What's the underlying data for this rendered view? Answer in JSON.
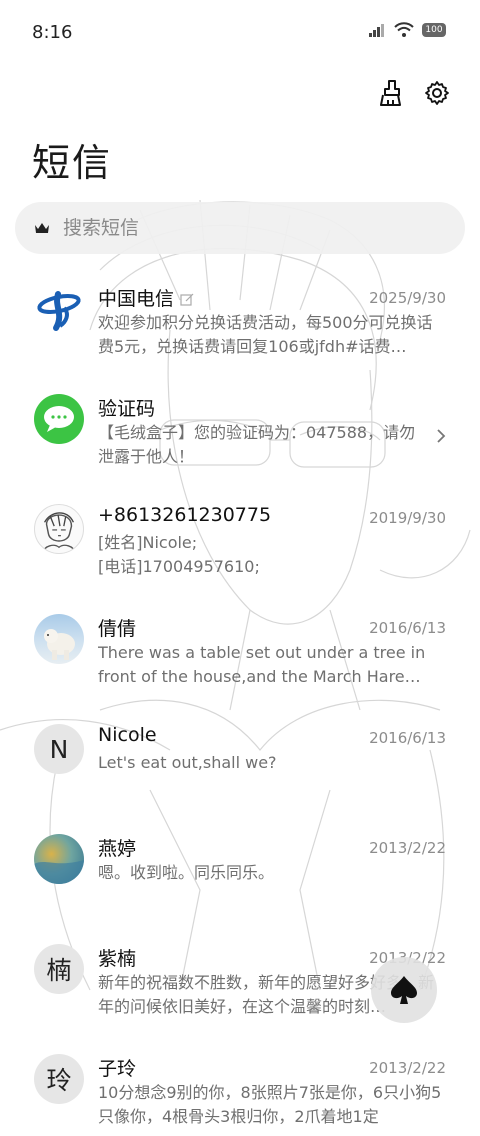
{
  "status_bar": {
    "time": "8:16",
    "battery": "100"
  },
  "page_title": "短信",
  "search": {
    "placeholder": "搜索短信"
  },
  "conversations": [
    {
      "name": "中国电信",
      "date": "2025/9/30",
      "preview": "欢迎参加积分兑换话费活动，每500分可兑换话费5元，兑换话费请回复106或jfdh#话费…",
      "avatar": "china-telecom-logo",
      "badge_icon": "edit-icon"
    },
    {
      "name": "验证码",
      "date": "",
      "preview": "【毛绒盒子】您的验证码为：047588，请勿泄露于他人！",
      "avatar": "message-bubble-icon",
      "has_chevron": true
    },
    {
      "name": "+8613261230775",
      "date": "2019/9/30",
      "preview": "[姓名]Nicole;\n[电话]17004957610;",
      "avatar": "anime-portrait"
    },
    {
      "name": "倩倩",
      "date": "2016/6/13",
      "preview": "There was a table set out under a tree in front of the house,and the March Hare an…",
      "avatar": "polar-bear-photo"
    },
    {
      "name": "Nicole",
      "date": "2016/6/13",
      "preview": "Let's eat out,shall we?",
      "avatar_letter": "N"
    },
    {
      "name": "燕婷",
      "date": "2013/2/22",
      "preview": "嗯。收到啦。同乐同乐。",
      "avatar": "ocean-photo"
    },
    {
      "name": "紫楠",
      "date": "2013/2/22",
      "preview": "新年的祝福数不胜数，新年的愿望好多好多，新年的问候依旧美好，在这个温馨的时刻…",
      "avatar_letter": "楠"
    },
    {
      "name": "子玲",
      "date": "2013/2/22",
      "preview": "10分想念9别的你，8张照片7张是你，6只小狗5只像你，4根骨头3根归你，2爪着地1定",
      "avatar_letter": "玲"
    }
  ],
  "colors": {
    "accent_green": "#3cc444",
    "telecom_blue": "#1a5fb4"
  },
  "fab": {
    "icon": "spade-icon"
  }
}
